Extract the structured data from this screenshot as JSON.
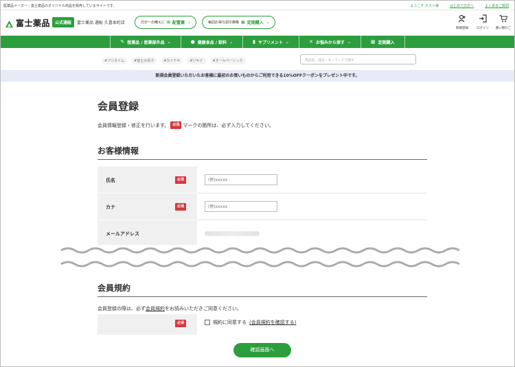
{
  "topbar": {
    "message": "医薬品メーカー・富士薬品のオリジナル商品を販売しているサイトです。",
    "welcome": "ようこそ ゲスト様",
    "first_time": "はじめての方へ",
    "faq": "よくあるご質問"
  },
  "header": {
    "logo_text": "富士薬品",
    "official_badge": "公式通販",
    "store_name": "富士薬品 通販 久喜本町店",
    "pill1_text": "万が一の備えに",
    "pill1_highlight": "配置薬",
    "pill2_text": "毎回お得な割引価格",
    "pill2_highlight": "定期購入",
    "icons": [
      {
        "label": "新規登録",
        "icon": "user-plus-icon"
      },
      {
        "label": "ログイン",
        "icon": "login-icon"
      },
      {
        "label": "買い物かご",
        "icon": "cart-icon"
      }
    ]
  },
  "nav": {
    "items": [
      {
        "label": "医薬品 / 医薬部外品",
        "icon": "pills-icon"
      },
      {
        "label": "健康食品 / 飲料",
        "icon": "apple-icon"
      },
      {
        "label": "サプリメント",
        "icon": "bottle-icon"
      },
      {
        "label": "お悩みから探す",
        "icon": "search-person-icon"
      },
      {
        "label": "定期購入",
        "icon": "calendar-icon"
      }
    ]
  },
  "tags": [
    "#フジタイム",
    "#富士の青汁",
    "#カイテキ",
    "#ジキナ",
    "#オールベーシック"
  ],
  "search": {
    "placeholder": "商品名・成分・キーワードで探す"
  },
  "banner": "新規会員登録いただいたお客様に最初のお買いものからご利用できる10%OFFクーポンをプレゼント中です。",
  "page": {
    "title": "会員登録",
    "intro_before": "会員情報登録・修正を行います。",
    "intro_after": "マークの箇所は、必ず入力してください。",
    "required_label": "必須"
  },
  "customer_section": {
    "title": "お客様情報",
    "rows": [
      {
        "label": "氏名",
        "required": "必須",
        "placeholder": "(例)xxxxx"
      },
      {
        "label": "カナ",
        "required": "必須",
        "placeholder": "(例)xxxxx"
      },
      {
        "label": "メールアドレス"
      }
    ]
  },
  "terms_section": {
    "title": "会員規約",
    "note_before": "会員登録の際は、必ず",
    "note_link": "会員規約",
    "note_after": "をお読みいただきご同意ください。",
    "required": "必須",
    "agree_text": "規約に同意する",
    "agree_link": "(会員規約を確認する)"
  },
  "confirm_button": "確認画面へ",
  "colors": {
    "brand_green": "#2d9e3e",
    "required_red": "#d9363e",
    "banner_blue": "#e6ebf7"
  }
}
